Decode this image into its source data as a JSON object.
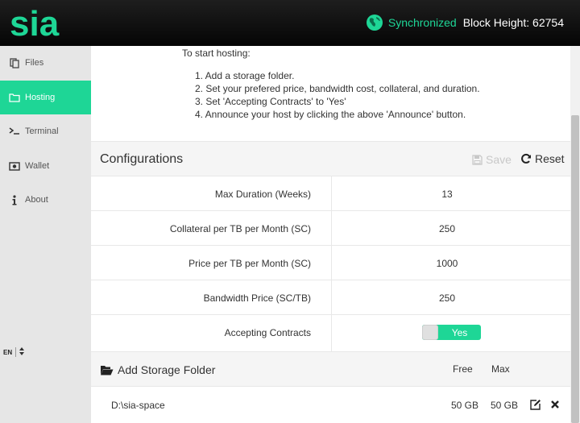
{
  "header": {
    "logo_text": "sia",
    "sync_status": "Synchronized",
    "block_height": "Block Height: 62754"
  },
  "sidebar": {
    "items": [
      {
        "label": "Files",
        "icon": "files-icon",
        "active": false
      },
      {
        "label": "Hosting",
        "icon": "folder-icon",
        "active": true
      },
      {
        "label": "Terminal",
        "icon": "terminal-icon",
        "active": false
      },
      {
        "label": "Wallet",
        "icon": "wallet-icon",
        "active": false
      },
      {
        "label": "About",
        "icon": "info-icon",
        "active": false
      }
    ],
    "language": "EN"
  },
  "intro": {
    "title": "To start hosting:",
    "steps": [
      "1. Add a storage folder.",
      "2. Set your prefered price, bandwidth cost, collateral, and duration.",
      "3. Set 'Accepting Contracts' to 'Yes'",
      "4. Announce your host by clicking the above 'Announce' button."
    ]
  },
  "configurations": {
    "title": "Configurations",
    "save_label": "Save",
    "reset_label": "Reset",
    "rows": [
      {
        "label": "Max Duration (Weeks)",
        "value": "13"
      },
      {
        "label": "Collateral per TB per Month (SC)",
        "value": "250"
      },
      {
        "label": "Price per TB per Month (SC)",
        "value": "1000"
      },
      {
        "label": "Bandwidth Price (SC/TB)",
        "value": "250"
      },
      {
        "label": "Accepting Contracts",
        "value": "Yes"
      }
    ]
  },
  "storage": {
    "title": "Add Storage Folder",
    "col_free": "Free",
    "col_max": "Max",
    "folders": [
      {
        "path": "D:\\sia-space",
        "free": "50 GB",
        "max": "50 GB"
      }
    ]
  },
  "colors": {
    "accent": "#1ed696",
    "header_bg": "#111111",
    "sidebar_bg": "#e6e6e6"
  }
}
